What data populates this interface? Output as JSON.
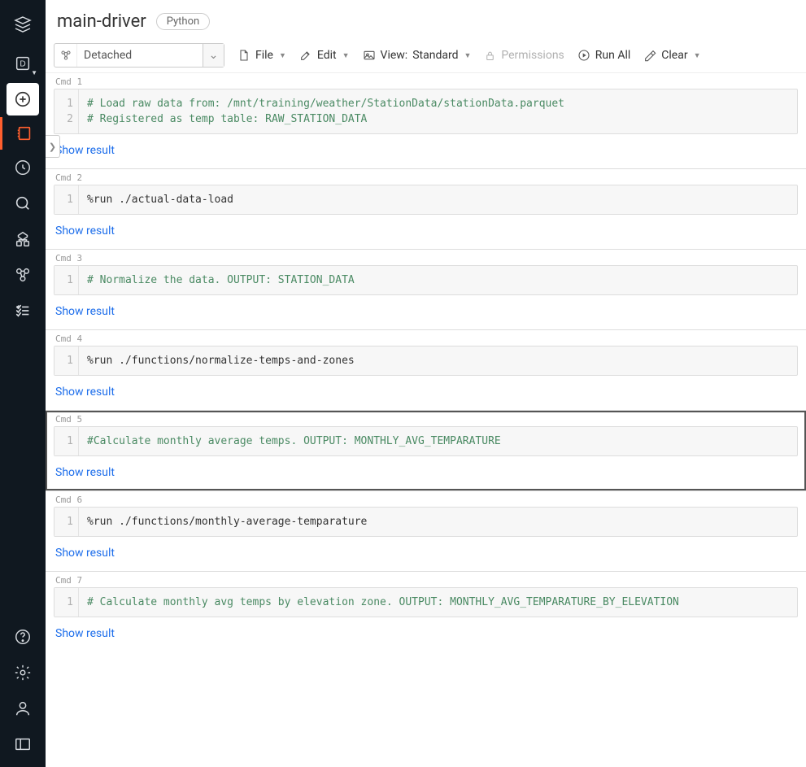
{
  "header": {
    "title": "main-driver",
    "language_badge": "Python"
  },
  "toolbar": {
    "attach": {
      "label": "Detached"
    },
    "file": "File",
    "edit": "Edit",
    "view_prefix": "View:",
    "view_value": "Standard",
    "permissions": "Permissions",
    "run_all": "Run All",
    "clear": "Clear"
  },
  "sidebar": {
    "items": [
      "logo",
      "workspace",
      "create",
      "notebook",
      "recent",
      "search",
      "branch",
      "pipeline",
      "checklist"
    ],
    "bottom": [
      "help",
      "settings",
      "user",
      "panel"
    ]
  },
  "show_result_label": "Show result",
  "cells": [
    {
      "cmd_label": "Cmd 1",
      "lines": [
        "1",
        "2"
      ],
      "code": "# Load raw data from: /mnt/training/weather/StationData/stationData.parquet\n# Registered as temp table: RAW_STATION_DATA",
      "is_comment": true,
      "selected": false
    },
    {
      "cmd_label": "Cmd 2",
      "lines": [
        "1"
      ],
      "code": "%run ./actual-data-load",
      "is_comment": false,
      "selected": false
    },
    {
      "cmd_label": "Cmd 3",
      "lines": [
        "1"
      ],
      "code": "# Normalize the data. OUTPUT: STATION_DATA",
      "is_comment": true,
      "selected": false
    },
    {
      "cmd_label": "Cmd 4",
      "lines": [
        "1"
      ],
      "code": "%run ./functions/normalize-temps-and-zones",
      "is_comment": false,
      "selected": false
    },
    {
      "cmd_label": "Cmd 5",
      "lines": [
        "1"
      ],
      "code": "#Calculate monthly average temps. OUTPUT: MONTHLY_AVG_TEMPARATURE",
      "is_comment": true,
      "selected": true
    },
    {
      "cmd_label": "Cmd 6",
      "lines": [
        "1"
      ],
      "code": "%run ./functions/monthly-average-temparature",
      "is_comment": false,
      "selected": false
    },
    {
      "cmd_label": "Cmd 7",
      "lines": [
        "1"
      ],
      "code": "# Calculate monthly avg temps by elevation zone. OUTPUT: MONTHLY_AVG_TEMPARATURE_BY_ELEVATION",
      "is_comment": true,
      "selected": false
    }
  ]
}
